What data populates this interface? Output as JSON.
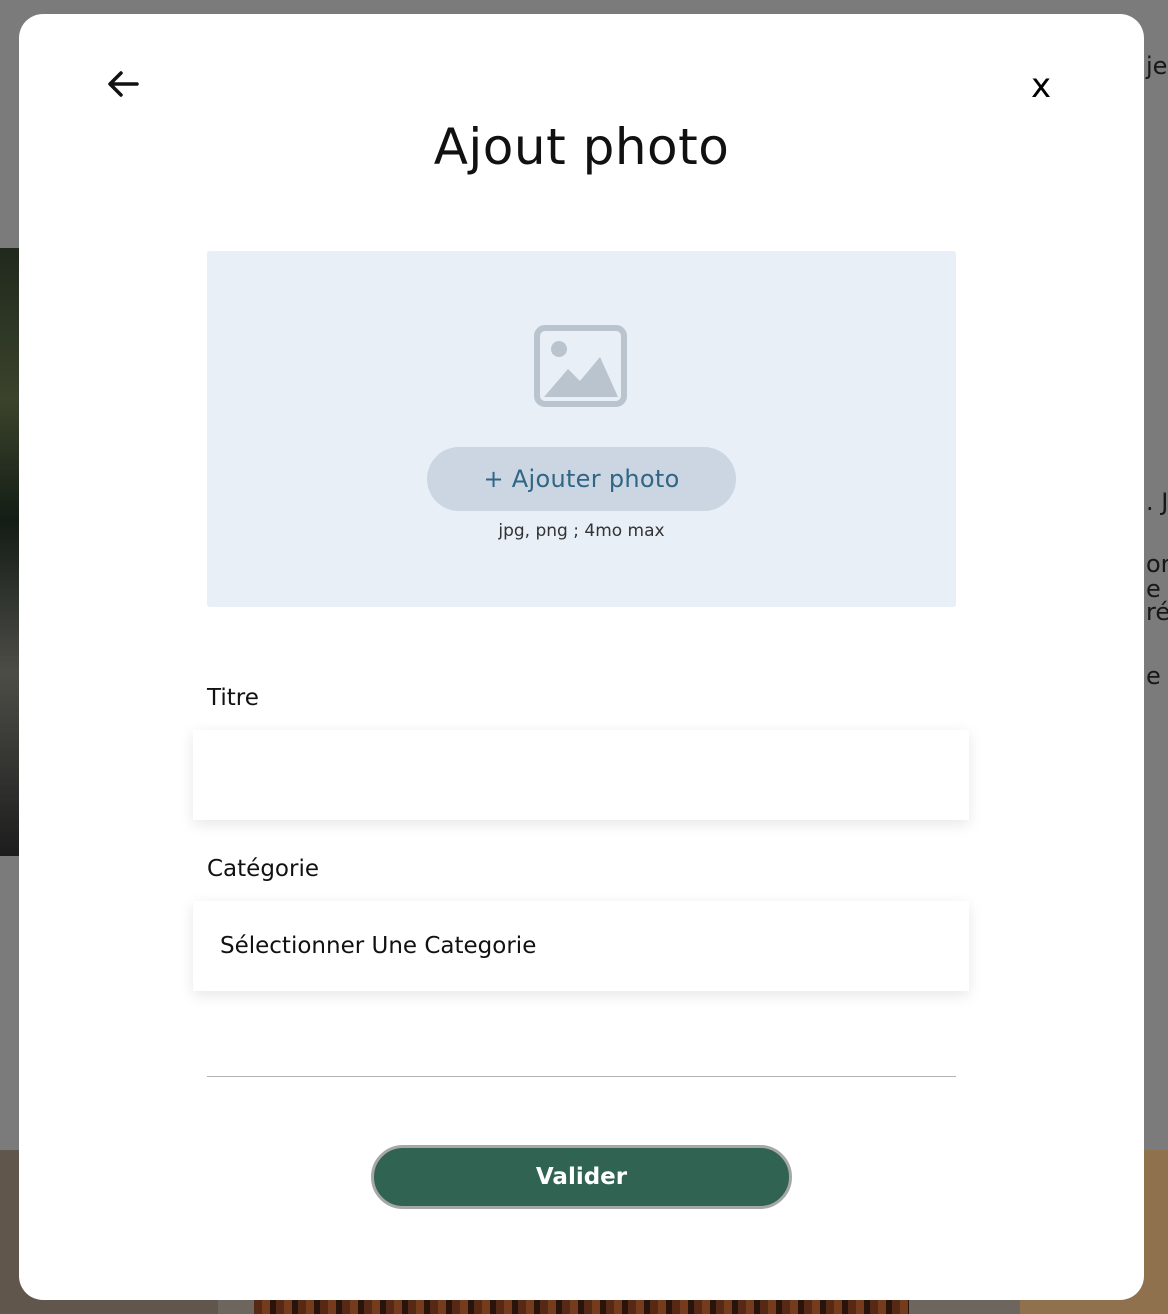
{
  "background": {
    "right_text_fragments": [
      "je",
      ". J",
      "or",
      "e",
      "ré",
      "e p"
    ]
  },
  "modal": {
    "back_icon": "arrow-left-icon",
    "close_label": "x",
    "title": "Ajout photo",
    "upload": {
      "icon": "image-placeholder-icon",
      "button_label": "+ Ajouter photo",
      "hint": "jpg, png ; 4mo max"
    },
    "fields": {
      "title_label": "Titre",
      "title_value": "",
      "category_label": "Catégorie",
      "category_selected": "Sélectionner Une Categorie"
    },
    "submit_label": "Valider"
  },
  "colors": {
    "upload_zone_bg": "#e8eff7",
    "upload_button_bg": "#cbd6e2",
    "upload_button_text": "#306685",
    "submit_bg": "#306351"
  }
}
